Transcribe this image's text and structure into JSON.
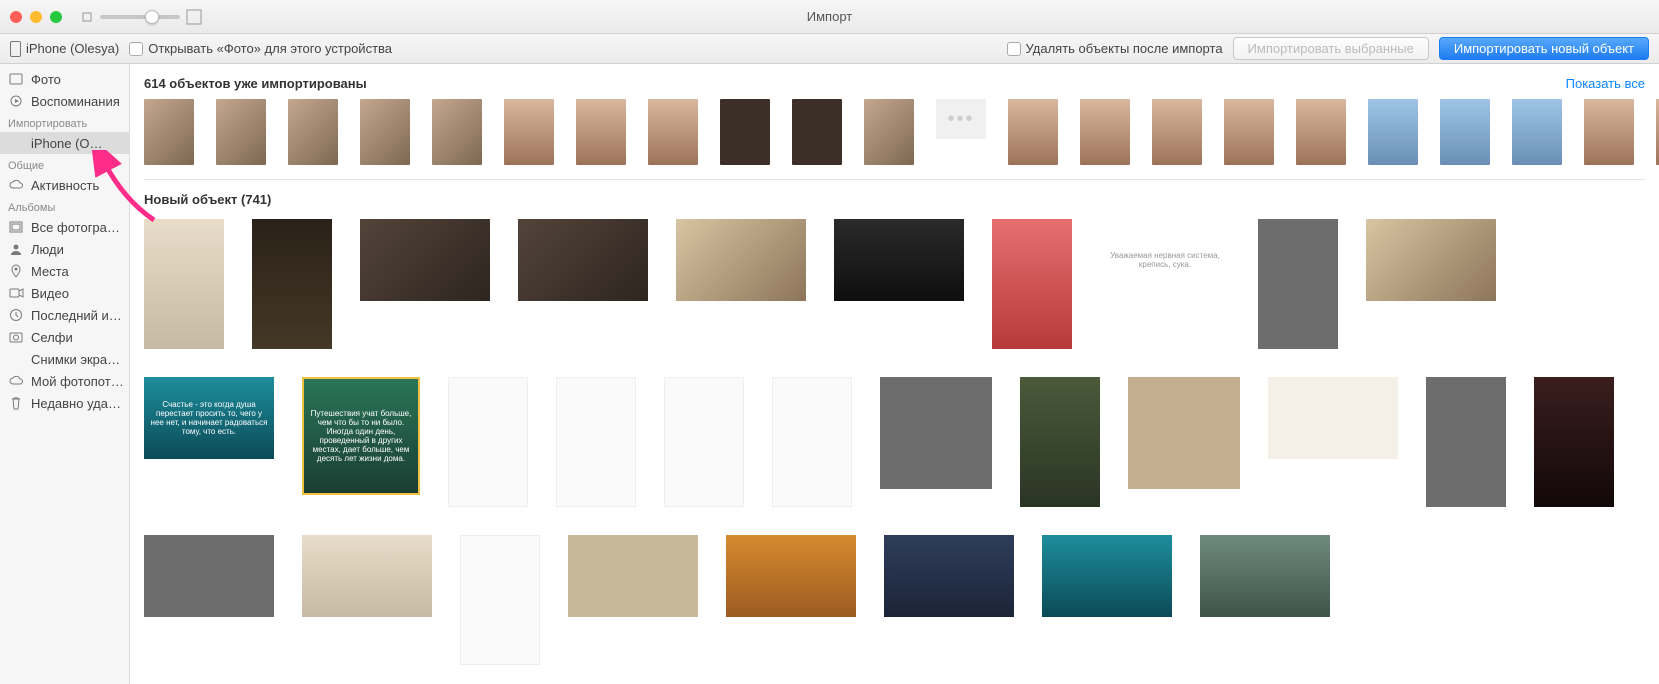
{
  "window": {
    "title": "Импорт"
  },
  "toolbar": {
    "device_name": "iPhone (Olesya)",
    "open_photos_label": "Открывать «Фото» для этого устройства",
    "delete_after_label": "Удалять объекты после импорта",
    "import_selected_label": "Импортировать выбранные",
    "import_new_label": "Импортировать новый объект"
  },
  "sidebar": {
    "library": [
      {
        "icon": "photos-icon",
        "label": "Фото"
      },
      {
        "icon": "memories-icon",
        "label": "Воспоминания"
      }
    ],
    "import_group_label": "Импортировать",
    "import": [
      {
        "icon": "iphone-icon",
        "label": "iPhone (O…"
      }
    ],
    "shared_group_label": "Общие",
    "shared": [
      {
        "icon": "cloud-icon",
        "label": "Активность"
      }
    ],
    "albums_group_label": "Альбомы",
    "albums": [
      {
        "icon": "all-photos-icon",
        "label": "Все фотогра…"
      },
      {
        "icon": "people-icon",
        "label": "Люди"
      },
      {
        "icon": "places-icon",
        "label": "Места"
      },
      {
        "icon": "video-icon",
        "label": "Видео"
      },
      {
        "icon": "clock-icon",
        "label": "Последний и…"
      },
      {
        "icon": "selfie-icon",
        "label": "Селфи"
      },
      {
        "icon": "screenshots-icon",
        "label": "Снимки экра…"
      },
      {
        "icon": "cloud-icon",
        "label": "Мой фотопот…"
      },
      {
        "icon": "trash-icon",
        "label": "Недавно уда…"
      }
    ]
  },
  "imported": {
    "title": "614 объектов уже импортированы",
    "show_all": "Показать все"
  },
  "new_section": {
    "title": "Новый объект (741)",
    "quote1": "Счастье - это когда душа перестает просить то, чего у нее нет, и начинает радоваться тому, что есть.",
    "quote2": "Путешествия учат больше, чем что бы то ни было. Иногда один день, проведенный в других местах, дает больше, чем десять лет жизни дома.",
    "text_card": "Уважаемая нервная система, крепись, сука."
  }
}
